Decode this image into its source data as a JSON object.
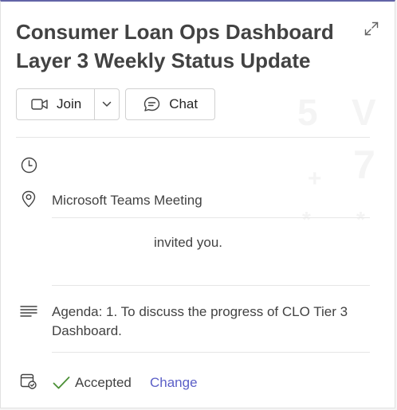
{
  "event": {
    "title": "Consumer Loan Ops Dashboard Layer 3 Weekly Status Update"
  },
  "actions": {
    "join_label": "Join",
    "chat_label": "Chat"
  },
  "details": {
    "time_text": "",
    "location": "Microsoft Teams Meeting",
    "organizer_text": "invited you.",
    "agenda": "Agenda: 1. To discuss the progress of CLO Tier 3 Dashboard."
  },
  "rsvp": {
    "status": "Accepted",
    "change_label": "Change"
  },
  "colors": {
    "accent": "#5b5fc7",
    "accepted_check": "#4a8f35",
    "text": "#424242"
  },
  "icons": [
    "expand-icon",
    "video-camera-icon",
    "chevron-down-icon",
    "chat-bubble-icon",
    "clock-icon",
    "location-pin-icon",
    "agenda-lines-icon",
    "calendar-status-icon",
    "checkmark-icon"
  ]
}
